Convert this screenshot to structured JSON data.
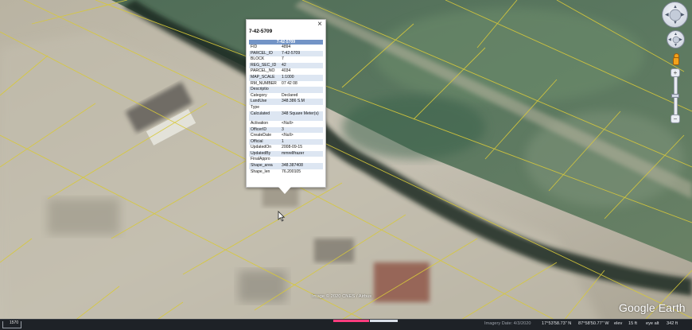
{
  "popup": {
    "title": "7-42-5709",
    "close": "×",
    "table_header": "7-42-5709",
    "rows": [
      {
        "k": "FID",
        "v": "4894"
      },
      {
        "k": "PARCEL_ID",
        "v": "7-42-5709"
      },
      {
        "k": "BLOCK",
        "v": "7"
      },
      {
        "k": "REG_SEC_ID",
        "v": "42"
      },
      {
        "k": "PARCEL_NO",
        "v": "4034"
      },
      {
        "k": "MAP_SCALE",
        "v": "1:1000"
      },
      {
        "k": "RM_NUMBER",
        "v": "07 42 08"
      },
      {
        "k": "Descriptio",
        "v": ""
      },
      {
        "k": "Category",
        "v": "Declared"
      },
      {
        "k": "LandUse",
        "v": "348.386 S.M"
      },
      {
        "k": "Type",
        "v": ""
      },
      {
        "k": "Calculated",
        "v": "348 Square Meter(s)"
      },
      {
        "k": "Activation",
        "v": "<Null>"
      },
      {
        "k": "OfficerID",
        "v": "3"
      },
      {
        "k": "CreateDate",
        "v": "<Null>"
      },
      {
        "k": "Official",
        "v": "1"
      },
      {
        "k": "UpdatedOn",
        "v": "2008-09-15"
      },
      {
        "k": "UpdatedBy",
        "v": "mmrellfrazer"
      },
      {
        "k": "FinalAppro",
        "v": ""
      },
      {
        "k": "Shape_area",
        "v": "348.387408"
      },
      {
        "k": "Shape_len",
        "v": "76.200105"
      }
    ]
  },
  "map": {
    "copyright": "Image © 2020 CNES / Airbus",
    "logo": "Google Earth"
  },
  "statusbar": {
    "scale_label": "1570",
    "imagery_date": "Imagery Date: 4/3/2020",
    "lat": "17°53'58.73\" N",
    "lon": "87°58'50.77\" W",
    "elev_label": "elev",
    "elev_value": "15 ft",
    "eye_label": "eye alt",
    "eye_value": "342 ft"
  },
  "colors": {
    "parcel_lines": "#d8c93a",
    "popup_header": "#7394c6",
    "progress_pink": "#ff3d7f"
  },
  "icons": [
    "close-icon",
    "look-around-icon",
    "move-pan-icon",
    "pegman-icon",
    "zoom-in-icon",
    "zoom-out-icon",
    "cursor-arrow-icon"
  ]
}
